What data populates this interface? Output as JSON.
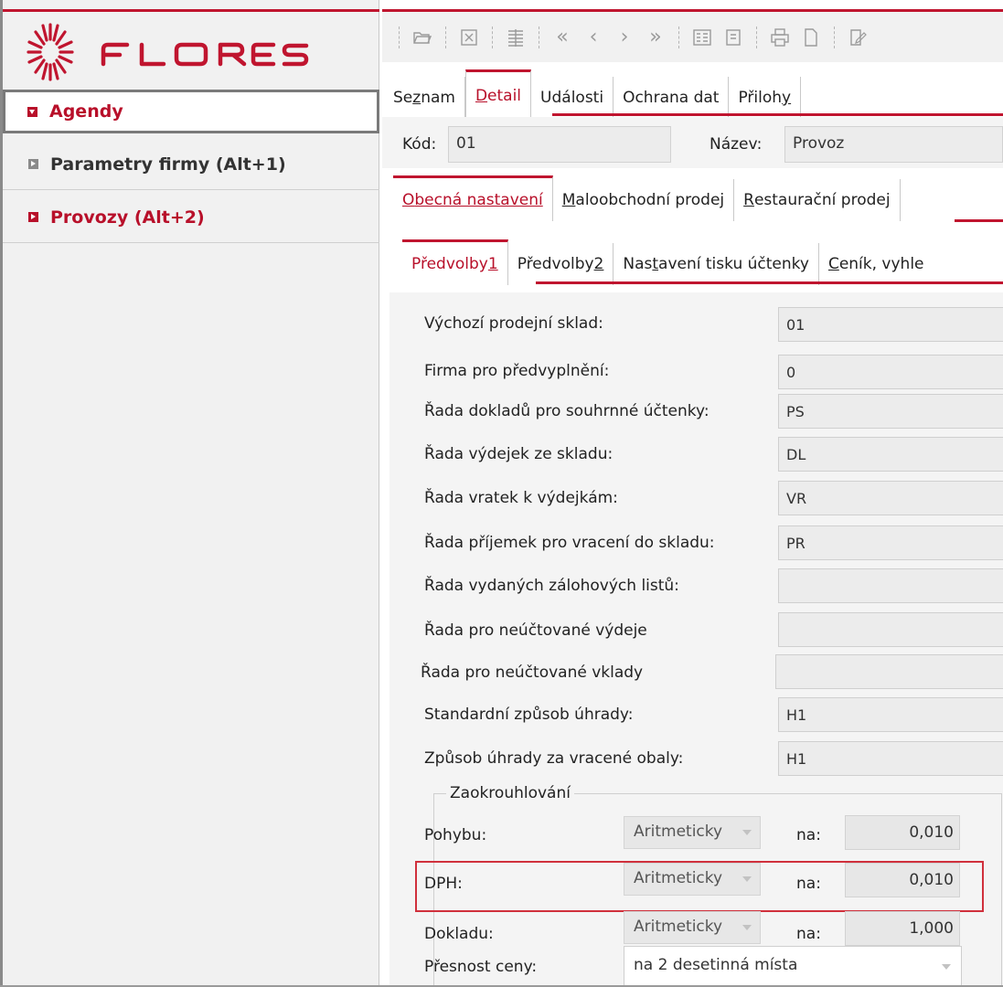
{
  "brand": {
    "name": "FLORES",
    "color": "#c0152f"
  },
  "sidebar": {
    "items": [
      {
        "label": "Agendy",
        "state": "expanded-selected"
      },
      {
        "label": "Parametry firmy (Alt+1)",
        "state": "collapsed"
      },
      {
        "label": "Provozy (Alt+2)",
        "state": "collapsed-active"
      }
    ]
  },
  "toolbar": {
    "icons": [
      "open-folder-icon",
      "close-record-icon",
      "list-view-icon",
      "first-record-icon",
      "previous-record-icon",
      "next-record-icon",
      "last-record-icon",
      "form-view-icon",
      "detail-view-icon",
      "print-icon",
      "new-document-icon",
      "edit-document-icon"
    ],
    "glyphs": {
      "first": "«",
      "prev": "‹",
      "next": "›",
      "last": "»"
    }
  },
  "tabs_main": [
    {
      "pre": "Se",
      "ul": "z",
      "post": "nam"
    },
    {
      "pre": "",
      "ul": "D",
      "post": "etail",
      "active": true
    },
    {
      "pre": "Události",
      "ul": "",
      "post": ""
    },
    {
      "pre": "Ochrana dat",
      "ul": "",
      "post": ""
    },
    {
      "pre": "Přiloh",
      "ul": "y",
      "post": ""
    }
  ],
  "header": {
    "kod_label": "Kód:",
    "kod_value": "01",
    "nazev_label": "Název:",
    "nazev_value": "Provoz"
  },
  "tabs_section": [
    {
      "pre": "",
      "ul": "O",
      "post": "becná nastavení",
      "active": true
    },
    {
      "pre": "",
      "ul": "M",
      "post": "aloobchodní prodej"
    },
    {
      "pre": "",
      "ul": "R",
      "post": "estaurační prodej"
    }
  ],
  "tabs_sub": [
    {
      "pre": "Předvolby ",
      "ul": "1",
      "post": "",
      "active": true
    },
    {
      "pre": "Předvolby ",
      "ul": "2",
      "post": ""
    },
    {
      "pre": "Nas",
      "ul": "t",
      "post": "avení tisku účtenky"
    },
    {
      "pre": "",
      "ul": "C",
      "post": "eník, vyhle"
    }
  ],
  "form": {
    "rows": [
      {
        "label": "Výchozí prodejní sklad:",
        "value": "01"
      },
      {
        "label": "Firma pro předvyplnění:",
        "value": "0"
      },
      {
        "label": "Řada dokladů pro souhrnné účtenky:",
        "value": "PS"
      },
      {
        "label": "Řada výdejek ze skladu:",
        "value": "DL"
      },
      {
        "label": "Řada vratek k výdejkám:",
        "value": "VR"
      },
      {
        "label": "Řada příjemek pro vracení do skladu:",
        "value": "PR"
      },
      {
        "label": "Řada vydaných zálohových listů:",
        "value": ""
      },
      {
        "label": "Řada pro neúčtované výdeje",
        "value": ""
      },
      {
        "label": "Řada pro neúčtované vklady",
        "value": ""
      },
      {
        "label": "Standardní způsob úhrady:",
        "value": "H1"
      },
      {
        "label": "Způsob úhrady za vracené obaly:",
        "value": "H1"
      }
    ]
  },
  "rounding": {
    "legend": "Zaokrouhlování",
    "na_label": "na:",
    "rows": [
      {
        "label": "Pohybu:",
        "method": "Aritmeticky",
        "value": "0,010"
      },
      {
        "label": "DPH:",
        "method": "Aritmeticky",
        "value": "0,010",
        "highlighted": true
      },
      {
        "label": "Dokladu:",
        "method": "Aritmeticky",
        "value": "1,000"
      }
    ],
    "precision_label": "Přesnost ceny:",
    "precision_value": "na 2 desetinná místa"
  }
}
